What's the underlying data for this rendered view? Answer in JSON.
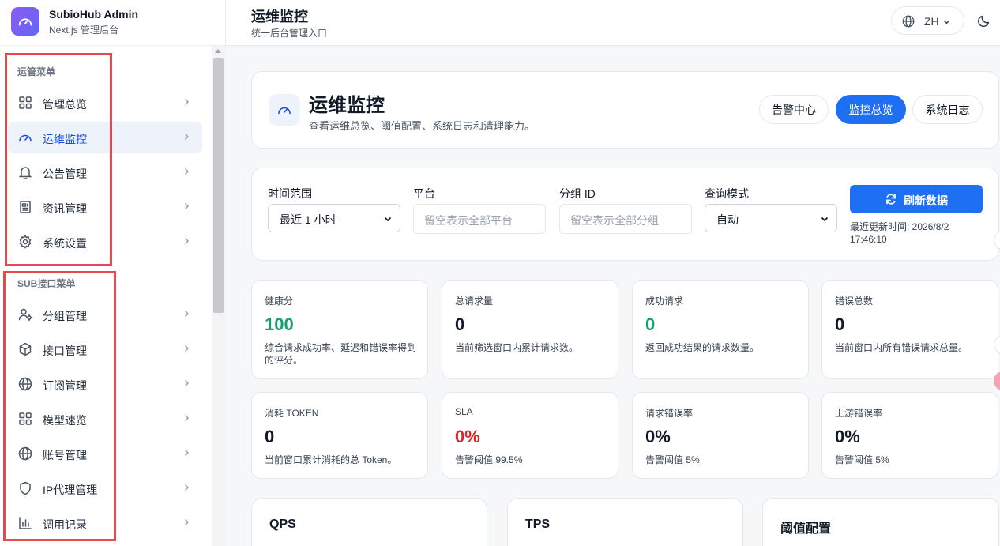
{
  "brand": {
    "title": "SubioHub Admin",
    "subtitle": "Next.js 管理后台"
  },
  "sidebar": {
    "section1": {
      "label": "运管菜单",
      "items": [
        {
          "label": "管理总览",
          "icon": "grid-icon"
        },
        {
          "label": "运维监控",
          "icon": "gauge-icon",
          "active": true
        },
        {
          "label": "公告管理",
          "icon": "bell-icon"
        },
        {
          "label": "资讯管理",
          "icon": "newspaper-icon"
        },
        {
          "label": "系统设置",
          "icon": "gear-icon"
        }
      ]
    },
    "section2": {
      "label": "SUB接口菜单",
      "items": [
        {
          "label": "分组管理",
          "icon": "users-gear-icon"
        },
        {
          "label": "接口管理",
          "icon": "cube-icon"
        },
        {
          "label": "订阅管理",
          "icon": "globe-icon"
        },
        {
          "label": "模型速览",
          "icon": "grid-icon"
        },
        {
          "label": "账号管理",
          "icon": "globe-icon"
        },
        {
          "label": "IP代理管理",
          "icon": "shield-icon"
        },
        {
          "label": "调用记录",
          "icon": "bar-chart-icon"
        }
      ]
    }
  },
  "header": {
    "title": "运维监控",
    "subtitle": "统一后台管理入口",
    "lang": "ZH"
  },
  "hero": {
    "title": "运维监控",
    "subtitle": "查看运维总览、阈值配置、系统日志和清理能力。",
    "tabs": [
      "告警中心",
      "监控总览",
      "系统日志"
    ],
    "active_tab": "监控总览"
  },
  "filters": {
    "time_range": {
      "label": "时间范围",
      "value": "最近 1 小时"
    },
    "platform": {
      "label": "平台",
      "placeholder": "留空表示全部平台"
    },
    "group_id": {
      "label": "分组 ID",
      "placeholder": "留空表示全部分组"
    },
    "query_mode": {
      "label": "查询模式",
      "value": "自动"
    },
    "refresh_label": "刷新数据",
    "updated_text": "最近更新时间: 2026/8/2 17:46:10"
  },
  "stats": [
    {
      "label": "健康分",
      "value": "100",
      "desc": "综合请求成功率、延迟和错误率得到的评分。",
      "color": "#16a06a"
    },
    {
      "label": "总请求量",
      "value": "0",
      "desc": "当前筛选窗口内累计请求数。",
      "color": "#111827"
    },
    {
      "label": "成功请求",
      "value": "0",
      "desc": "返回成功结果的请求数量。",
      "color": "#16a06a"
    },
    {
      "label": "错误总数",
      "value": "0",
      "desc": "当前窗口内所有错误请求总量。",
      "color": "#111827"
    },
    {
      "label": "消耗 TOKEN",
      "value": "0",
      "desc": "当前窗口累计消耗的总 Token。",
      "color": "#111827"
    },
    {
      "label": "SLA",
      "value": "0%",
      "desc": "告警阈值 99.5%",
      "color": "#dc2626"
    },
    {
      "label": "请求错误率",
      "value": "0%",
      "desc": "告警阈值 5%",
      "color": "#111827"
    },
    {
      "label": "上游错误率",
      "value": "0%",
      "desc": "告警阈值 5%",
      "color": "#111827"
    }
  ],
  "bottom_cards": [
    "QPS",
    "TPS",
    "阈值配置"
  ],
  "colors": {
    "primary": "#1f6ff2",
    "highlight_box": "#e5484d"
  }
}
